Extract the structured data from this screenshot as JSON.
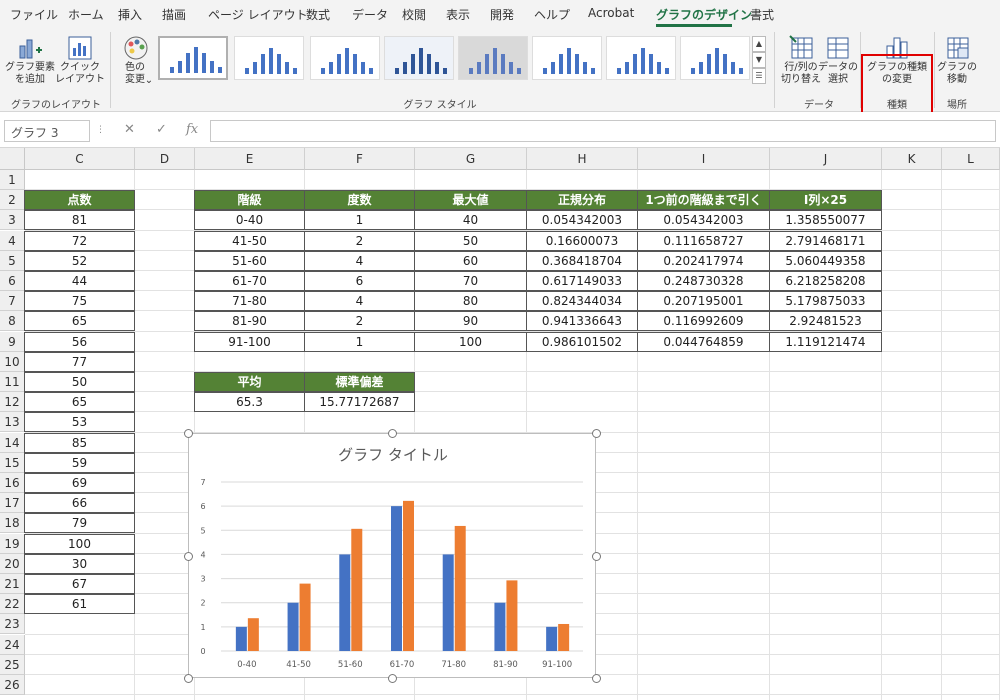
{
  "tabs": [
    "ファイル",
    "ホーム",
    "挿入",
    "描画",
    "ページ レイアウト",
    "数式",
    "データ",
    "校閲",
    "表示",
    "開発",
    "ヘルプ",
    "Acrobat",
    "グラフのデザイン",
    "書式"
  ],
  "ribbon": {
    "add_element": "グラフ要素\nを追加",
    "quick_layout": "クイック\nレイアウト",
    "change_color": "色の\n変更",
    "layout_group": "グラフのレイアウト",
    "style_group": "グラフ スタイル",
    "switch_row_col": "行/列の\n切り替え",
    "select_data": "データの\n選択",
    "data_group": "データ",
    "change_type": "グラフの種類\nの変更",
    "type_group": "種類",
    "move_chart": "グラフの\n移動",
    "location_group": "場所",
    "highlight_color": "#e00000",
    "accent_color": "#217346"
  },
  "formula_bar": {
    "name_box": "グラフ 3",
    "fx": "fx",
    "cancel": "✕",
    "confirm": "✓"
  },
  "columns": [
    "C",
    "D",
    "E",
    "F",
    "G",
    "H",
    "I",
    "J",
    "K",
    "L"
  ],
  "rows": [
    "1",
    "2",
    "3",
    "4",
    "5",
    "6",
    "7",
    "8",
    "9",
    "10",
    "11",
    "12",
    "13",
    "14",
    "15",
    "16",
    "17",
    "18",
    "19",
    "20",
    "21",
    "22",
    "23",
    "24",
    "25",
    "26"
  ],
  "scores": {
    "header": "点数",
    "values": [
      "81",
      "72",
      "52",
      "44",
      "75",
      "65",
      "56",
      "77",
      "50",
      "65",
      "53",
      "85",
      "59",
      "69",
      "66",
      "79",
      "100",
      "30",
      "67",
      "61"
    ]
  },
  "freq_table": {
    "headers": [
      "階級",
      "度数",
      "最大値",
      "正規分布",
      "1つ前の階級まで引く",
      "I列×25"
    ],
    "rows": [
      [
        "0-40",
        "1",
        "40",
        "0.054342003",
        "0.054342003",
        "1.358550077"
      ],
      [
        "41-50",
        "2",
        "50",
        "0.16600073",
        "0.111658727",
        "2.791468171"
      ],
      [
        "51-60",
        "4",
        "60",
        "0.368418704",
        "0.202417974",
        "5.060449358"
      ],
      [
        "61-70",
        "6",
        "70",
        "0.617149033",
        "0.248730328",
        "6.218258208"
      ],
      [
        "71-80",
        "4",
        "80",
        "0.824344034",
        "0.207195001",
        "5.179875033"
      ],
      [
        "81-90",
        "2",
        "90",
        "0.941336643",
        "0.116992609",
        "2.92481523"
      ],
      [
        "91-100",
        "1",
        "100",
        "0.986101502",
        "0.044764859",
        "1.119121474"
      ]
    ]
  },
  "stats": {
    "mean_label": "平均",
    "sd_label": "標準偏差",
    "mean": "65.3",
    "sd": "15.77172687"
  },
  "header_color": "#548235",
  "chart_data": {
    "type": "bar",
    "title": "グラフ タイトル",
    "categories": [
      "0-40",
      "41-50",
      "51-60",
      "61-70",
      "71-80",
      "81-90",
      "91-100"
    ],
    "series": [
      {
        "values": [
          1,
          2,
          4,
          6,
          4,
          2,
          1
        ],
        "color": "#4472c4"
      },
      {
        "values": [
          1.358550077,
          2.791468171,
          5.060449358,
          6.218258208,
          5.179875033,
          2.92481523,
          1.119121474
        ],
        "color": "#ed7d31"
      }
    ],
    "ylim": [
      0,
      7
    ],
    "yticks": [
      "0",
      "1",
      "2",
      "3",
      "4",
      "5",
      "6",
      "7"
    ],
    "grid": true
  }
}
